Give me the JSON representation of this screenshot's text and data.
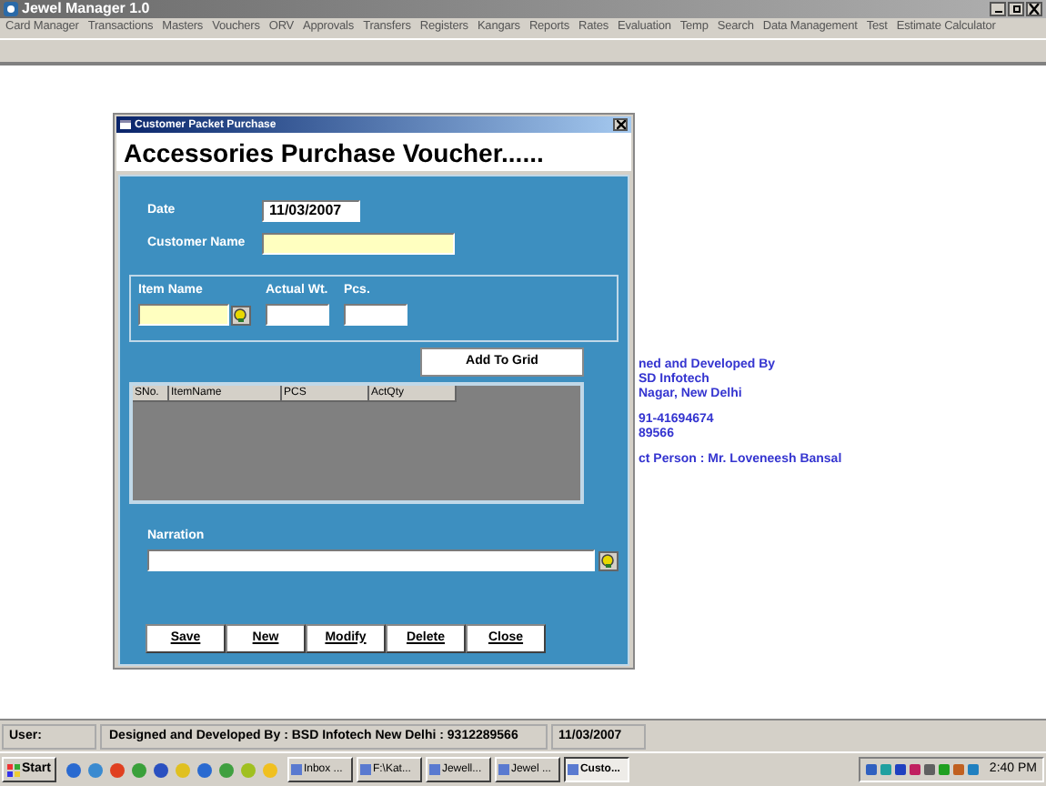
{
  "window": {
    "title": "Jewel Manager 1.0"
  },
  "menu": [
    "Card Manager",
    "Transactions",
    "Masters",
    "Vouchers",
    "ORV",
    "Approvals",
    "Transfers",
    "Registers",
    "Kangars",
    "Reports",
    "Rates",
    "Evaluation",
    "Temp",
    "Search",
    "Data Management",
    "Test",
    "Estimate Calculator"
  ],
  "credits": [
    [
      "ned and Developed By",
      "SD Infotech",
      "Nagar, New Delhi"
    ],
    [
      "91-41694674",
      "89566"
    ],
    [
      "ct Person : Mr. Loveneesh Bansal"
    ]
  ],
  "dialog": {
    "title": "Customer Packet Purchase",
    "heading": "Accessories Purchase Voucher......",
    "date": {
      "label": "Date",
      "value": "11/03/2007"
    },
    "customer_name": {
      "label": "Customer Name"
    },
    "item_fields": [
      {
        "label": "Item Name",
        "kind": "lookup"
      },
      {
        "label": "Actual Wt.",
        "kind": "plain"
      },
      {
        "label": "Pcs.",
        "kind": "plain"
      }
    ],
    "add_button": "Add To Grid",
    "grid": {
      "columns": [
        "SNo.",
        "ItemName",
        "PCS",
        "ActQty"
      ]
    },
    "narration": {
      "label": "Narration"
    },
    "buttons": [
      "Save",
      "New",
      "Modify",
      "Delete",
      "Close"
    ]
  },
  "status_bar": {
    "user": "User:",
    "credit": "Designed and Developed By : BSD Infotech New Delhi : 9312289566",
    "date": "11/03/2007"
  },
  "taskbar": {
    "start": "Start",
    "tasks": [
      {
        "label": "Inbox ...",
        "selected": false
      },
      {
        "label": "F:\\Kat...",
        "selected": false
      },
      {
        "label": "Jewell...",
        "selected": false
      },
      {
        "label": "Jewel ...",
        "selected": false
      },
      {
        "label": "Custo...",
        "selected": true
      }
    ],
    "clock": "2:40 PM"
  }
}
